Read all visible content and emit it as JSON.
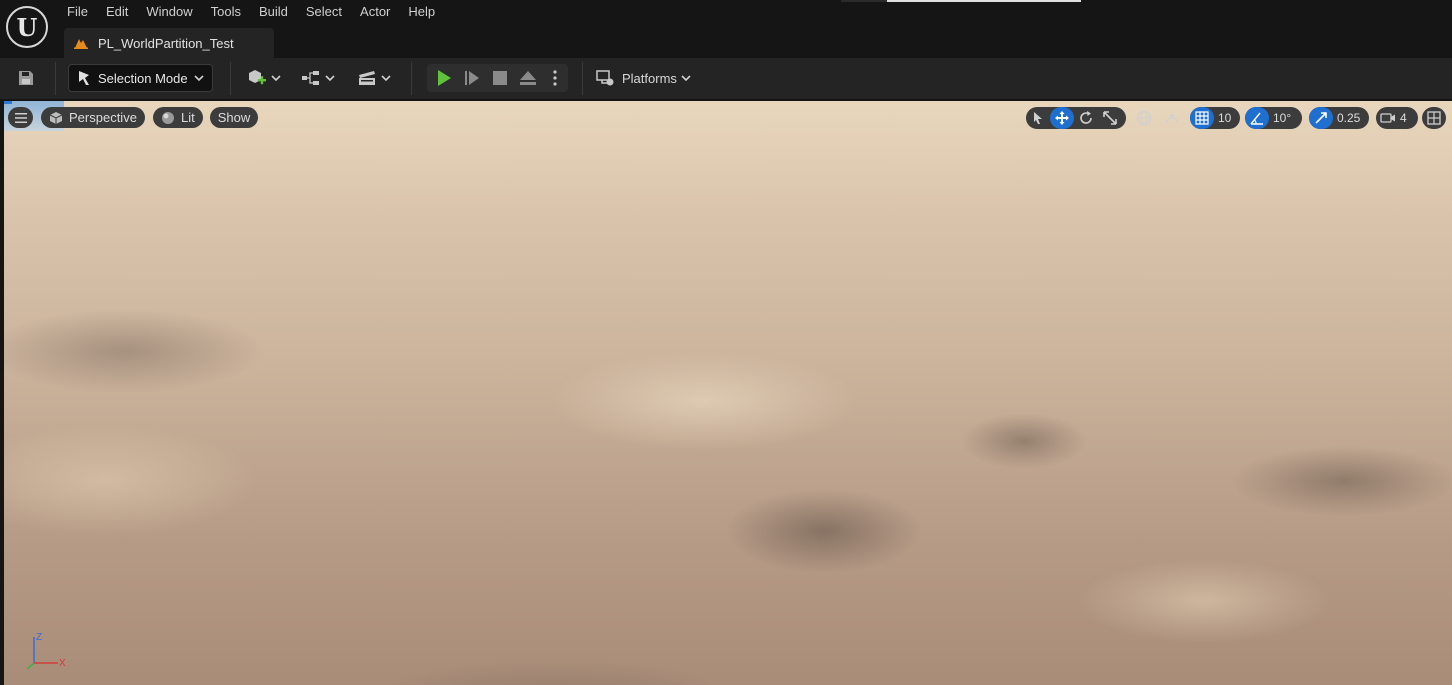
{
  "menu": {
    "items": [
      "File",
      "Edit",
      "Window",
      "Tools",
      "Build",
      "Select",
      "Actor",
      "Help"
    ]
  },
  "level_tab": {
    "label": "PL_WorldPartition_Test"
  },
  "toolbar": {
    "mode_label": "Selection Mode",
    "platforms_label": "Platforms"
  },
  "viewport": {
    "perspective_label": "Perspective",
    "lit_label": "Lit",
    "show_label": "Show",
    "grid_snap_value": "10",
    "rotation_snap_value": "10°",
    "scale_snap_value": "0.25",
    "camera_speed_value": "4",
    "axis_z": "Z",
    "axis_x": "X"
  },
  "colors": {
    "accent": "#1f6fd1",
    "play_green": "#5fc23a",
    "level_icon": "#e58a1b"
  },
  "icons": [
    "ue-logo",
    "save-icon",
    "selection-mode-icon",
    "add-actor-icon",
    "blueprint-icon",
    "cinematics-icon",
    "play-icon",
    "skip-icon",
    "stop-icon",
    "eject-icon",
    "kebab-icon",
    "platforms-icon",
    "hamburger-icon",
    "cube-icon",
    "sphere-icon",
    "select-icon",
    "translate-icon",
    "rotate-icon",
    "scale-icon",
    "world-icon",
    "surface-snap-icon",
    "grid-icon",
    "angle-icon",
    "scale-snap-icon",
    "camera-icon",
    "layout-icon"
  ]
}
